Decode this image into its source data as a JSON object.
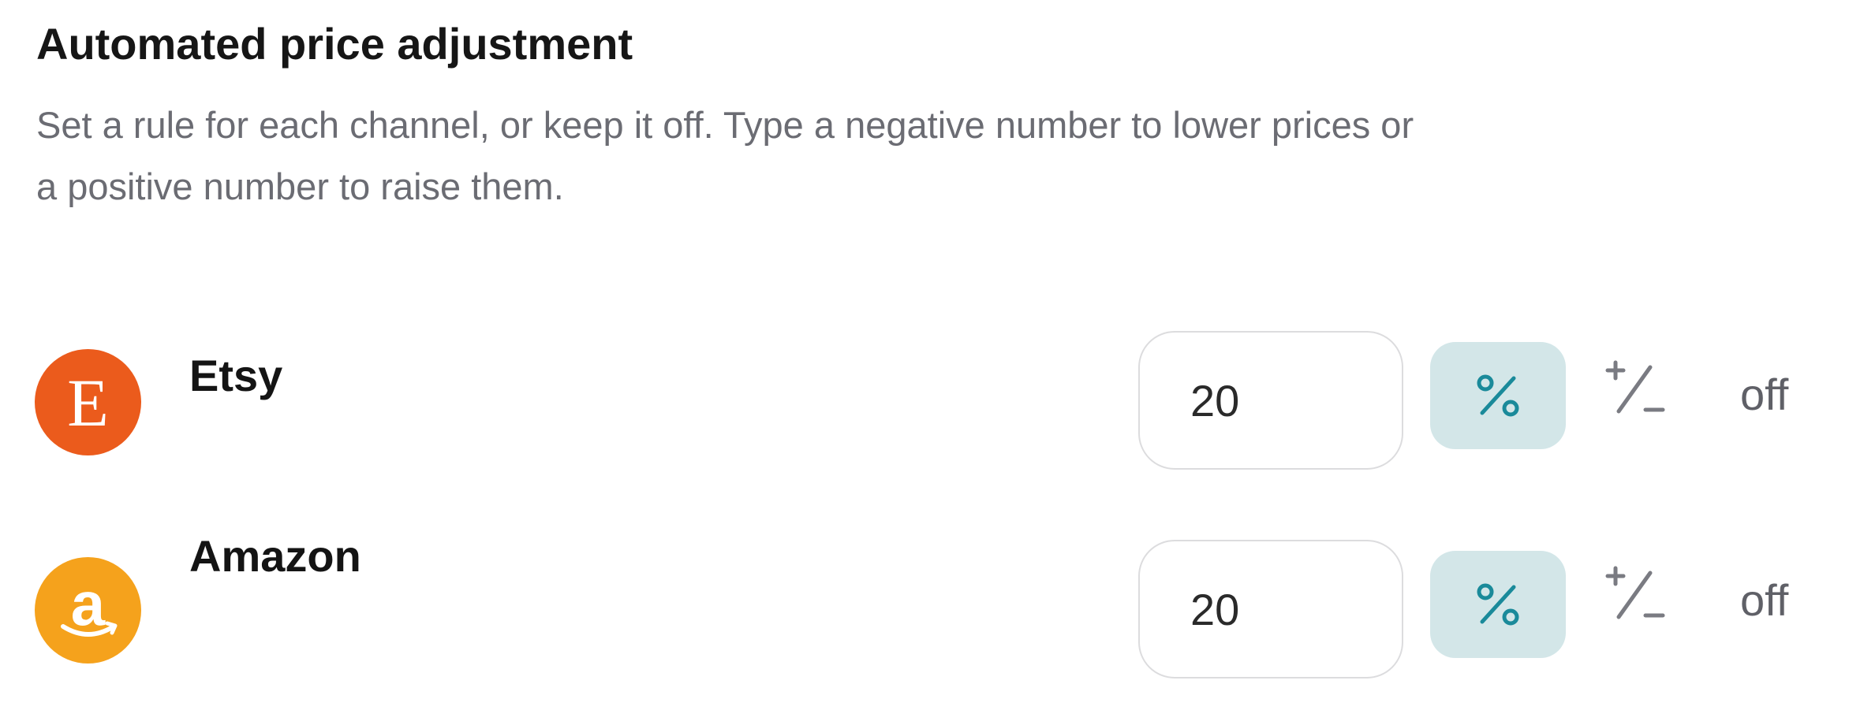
{
  "section": {
    "title": "Automated price adjustment",
    "description": "Set a rule for each channel, or keep it off. Type a negative number to lower prices or a positive number to raise them."
  },
  "colors": {
    "etsy_brand": "#eb5b1c",
    "amazon_brand": "#f5a21c",
    "unit_button_bg": "#d3e6e8",
    "unit_icon": "#1a8a9a"
  },
  "channels": [
    {
      "name": "Etsy",
      "logo_glyph": "E",
      "logo_icon": "etsy-logo-icon",
      "value": "20",
      "unit_icon": "percent-icon",
      "sign_icon": "plus-minus-icon",
      "state": "off"
    },
    {
      "name": "Amazon",
      "logo_glyph": "a",
      "logo_icon": "amazon-logo-icon",
      "value": "20",
      "unit_icon": "percent-icon",
      "sign_icon": "plus-minus-icon",
      "state": "off"
    }
  ]
}
